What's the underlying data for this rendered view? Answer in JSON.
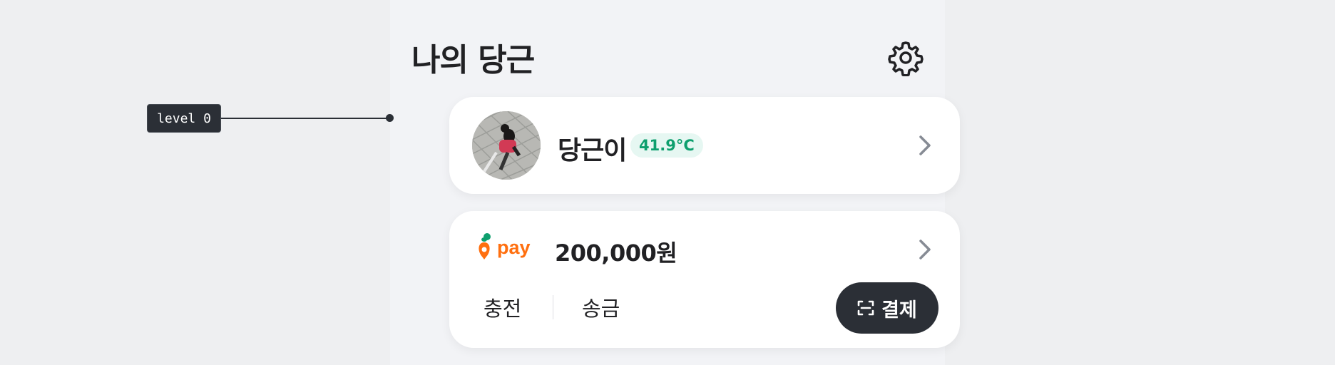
{
  "debug_label": "level 0",
  "header": {
    "title": "나의 당근",
    "settings_icon": "gear-icon"
  },
  "profile": {
    "nickname": "당근이",
    "temperature": "41.9°C",
    "avatar_icon": "dog-photo"
  },
  "pay": {
    "logo_text": "pay",
    "balance": "200,000원",
    "charge_label": "충전",
    "transfer_label": "송금",
    "pay_button_label": "결제"
  },
  "colors": {
    "brand_orange": "#ff6f0f",
    "brand_green": "#0e9f6e",
    "dark_button": "#2b2f36",
    "temperature_bg": "#e6f7f2"
  }
}
